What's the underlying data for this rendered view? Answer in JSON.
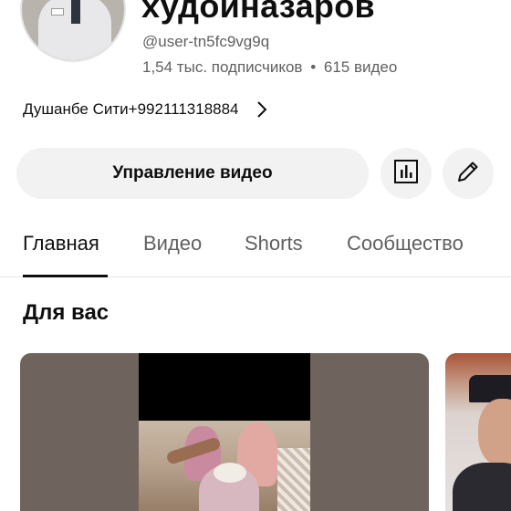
{
  "channel": {
    "name": "худойназаров",
    "handle": "@user-tn5fc9vg9q",
    "subscribers": "1,54 тыс. подписчиков",
    "separator": "•",
    "videos": "615 видео",
    "location_link": "Душанбе Сити+992111318884"
  },
  "actions": {
    "manage_videos": "Управление видео",
    "stats_icon": "analytics-icon",
    "edit_icon": "pencil-icon"
  },
  "tabs": [
    {
      "label": "Главная",
      "active": true
    },
    {
      "label": "Видео",
      "active": false
    },
    {
      "label": "Shorts",
      "active": false
    },
    {
      "label": "Сообщество",
      "active": false
    }
  ],
  "section": {
    "title": "Для вас"
  },
  "colors": {
    "text_primary": "#0f0f0f",
    "text_secondary": "#606060",
    "button_bg": "#f2f2f2"
  }
}
